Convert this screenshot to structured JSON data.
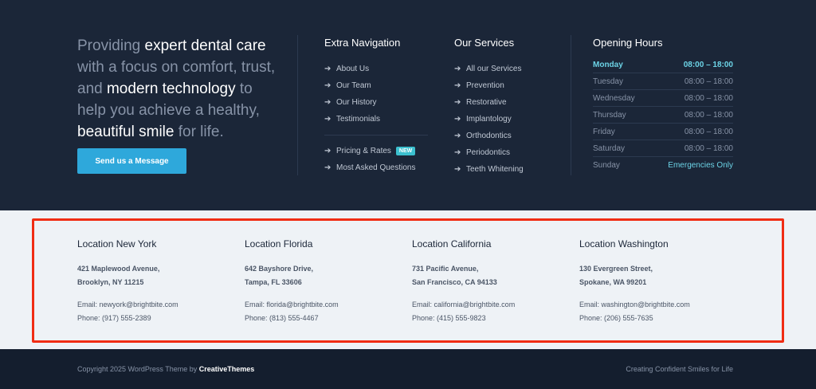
{
  "intro": {
    "p1": "Providing ",
    "b1": "expert dental care",
    "p2": " with a focus on comfort, trust, and ",
    "b2": "modern technology",
    "p3": " to help you achieve a healthy, ",
    "b3": "beautiful smile",
    "p4": " for life."
  },
  "cta_label": "Send us a Message",
  "extra_nav": {
    "title": "Extra Navigation",
    "items": [
      "About Us",
      "Our Team",
      "Our History",
      "Testimonials"
    ],
    "items2": [
      "Pricing & Rates",
      "Most Asked Questions"
    ],
    "badge": "NEW"
  },
  "services": {
    "title": "Our Services",
    "items": [
      "All our Services",
      "Prevention",
      "Restorative",
      "Implantology",
      "Orthodontics",
      "Periodontics",
      "Teeth Whitening"
    ]
  },
  "hours": {
    "title": "Opening Hours",
    "rows": [
      {
        "day": "Monday",
        "time": "08:00 – 18:00"
      },
      {
        "day": "Tuesday",
        "time": "08:00 – 18:00"
      },
      {
        "day": "Wednesday",
        "time": "08:00 – 18:00"
      },
      {
        "day": "Thursday",
        "time": "08:00 – 18:00"
      },
      {
        "day": "Friday",
        "time": "08:00 – 18:00"
      },
      {
        "day": "Saturday",
        "time": "08:00 – 18:00"
      },
      {
        "day": "Sunday",
        "time": "Emergencies Only"
      }
    ]
  },
  "locations": [
    {
      "title": "Location New York",
      "addr1": "421 Maplewood Avenue,",
      "addr2": "Brooklyn, NY 11215",
      "email": "Email: newyork@brightbite.com",
      "phone": "Phone: (917) 555-2389"
    },
    {
      "title": "Location Florida",
      "addr1": "642 Bayshore Drive,",
      "addr2": "Tampa, FL 33606",
      "email": "Email: florida@brightbite.com",
      "phone": "Phone: (813) 555-4467"
    },
    {
      "title": "Location California",
      "addr1": "731 Pacific Avenue,",
      "addr2": "San Francisco, CA 94133",
      "email": "Email: california@brightbite.com",
      "phone": "Phone: (415) 555-9823"
    },
    {
      "title": "Location Washington",
      "addr1": "130 Evergreen Street,",
      "addr2": "Spokane, WA 99201",
      "email": "Email: washington@brightbite.com",
      "phone": "Phone: (206) 555-7635"
    }
  ],
  "footer": {
    "copy_prefix": "Copyright 2025 WordPress Theme by ",
    "copy_brand": "CreativeThemes",
    "tagline": "Creating Confident Smiles for Life"
  },
  "colors": {
    "accent": "#2ea8db",
    "highlight_box": "#f02d14",
    "dark_bg": "#1b2638",
    "light_bg": "#eef2f6",
    "today": "#6cd3e6"
  }
}
